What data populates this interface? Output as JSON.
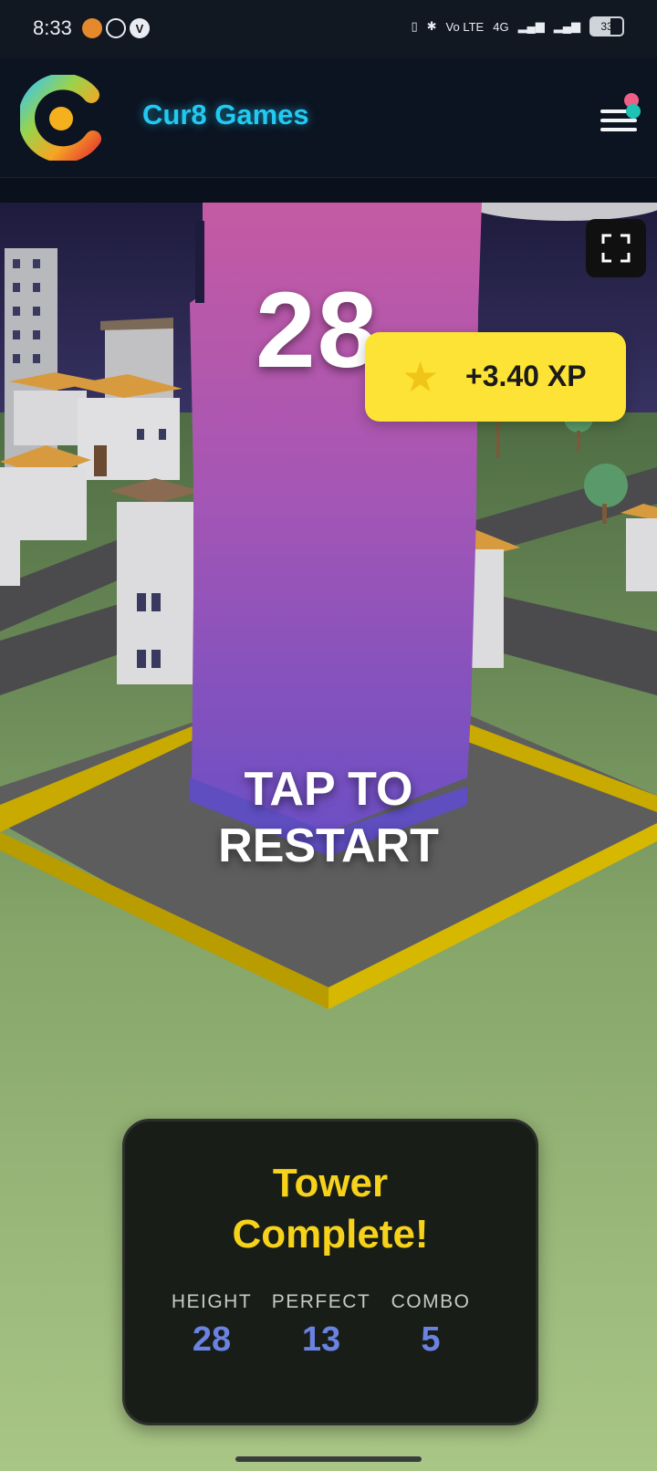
{
  "status_bar": {
    "time": "8:33",
    "network_labels": [
      "Vo LTE",
      "4G"
    ],
    "battery": "33"
  },
  "header": {
    "brand": "Cur8 Games"
  },
  "game": {
    "score": "28",
    "xp_badge": "+3.40 XP",
    "prompt_line1": "TAP TO",
    "prompt_line2": "RESTART"
  },
  "result": {
    "title_line1": "Tower",
    "title_line2": "Complete!",
    "stats": [
      {
        "label": "HEIGHT",
        "value": "28"
      },
      {
        "label": "PERFECT",
        "value": "13"
      },
      {
        "label": "COMBO",
        "value": "5"
      }
    ]
  },
  "colors": {
    "brand": "#22c9f2",
    "xp_badge_bg": "#fde335",
    "card_title": "#f7d21a",
    "stat_value": "#6a82e2"
  },
  "icons": [
    "cur8-logo-icon",
    "menu-icon",
    "fullscreen-icon",
    "star-icon"
  ]
}
